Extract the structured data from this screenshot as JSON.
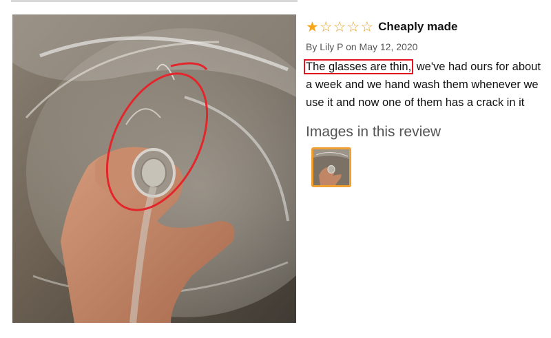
{
  "review": {
    "rating": 1,
    "rating_max": 5,
    "title": "Cheaply made",
    "byline": "By Lily P on May 12, 2020",
    "body_highlight": "The glasses are thin,",
    "body_rest": " we've had ours for about a week and we hand wash them whenever we use it and now one of them has a crack in it",
    "images_heading": "Images in this review"
  },
  "colors": {
    "star": "#f7a51c",
    "highlight_box": "#e0141e",
    "annotation_circle": "#e3262c",
    "thumb_border": "#f0a030"
  },
  "icons": {
    "star_filled": "star-filled-icon",
    "star_empty": "star-empty-icon"
  }
}
